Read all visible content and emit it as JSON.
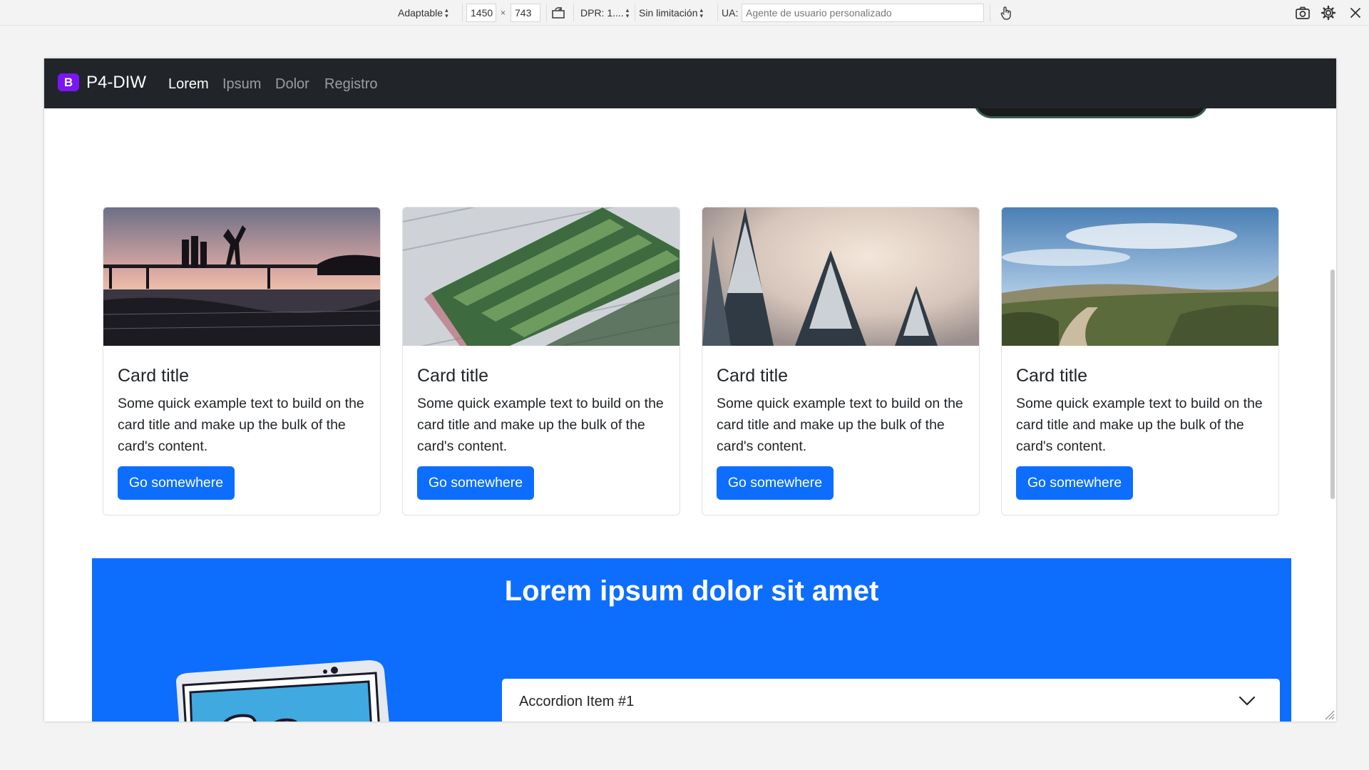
{
  "toolbar": {
    "device": "Adaptable",
    "width": "1450",
    "times": "×",
    "height": "743",
    "dpr": "DPR: 1....",
    "throttle": "Sin limitación",
    "ua_label": "UA:",
    "ua_placeholder": "Agente de usuario personalizado",
    "icons": [
      "rotate-icon",
      "touch-icon",
      "screenshot-icon",
      "settings-icon",
      "close-icon"
    ]
  },
  "navbar": {
    "logo": "B",
    "brand": "P4-DIW",
    "links": [
      {
        "label": "Lorem",
        "active": true
      },
      {
        "label": "Ipsum",
        "active": false
      },
      {
        "label": "Dolor",
        "active": false
      },
      {
        "label": "Registro",
        "active": false
      }
    ]
  },
  "cards": [
    {
      "title": "Card title",
      "text": "Some quick example text to build on the card title and make up the bulk of the card's content.",
      "button": "Go somewhere",
      "image": "people-jumping-lake-sunset"
    },
    {
      "title": "Card title",
      "text": "Some quick example text to build on the card title and make up the bulk of the card's content.",
      "button": "Go somewhere",
      "image": "aerial-football-stadium"
    },
    {
      "title": "Card title",
      "text": "Some quick example text to build on the card title and make up the bulk of the card's content.",
      "button": "Go somewhere",
      "image": "snowy-pine-trees-fog"
    },
    {
      "title": "Card title",
      "text": "Some quick example text to build on the card title and make up the bulk of the card's content.",
      "button": "Go somewhere",
      "image": "mountain-valley-road"
    }
  ],
  "section": {
    "title": "Lorem ipsum dolor sit amet",
    "accordion_item": "Accordion Item #1"
  },
  "colors": {
    "primary": "#0d6efd",
    "navbar": "#212529",
    "brand_logo": "#7a16f5"
  }
}
